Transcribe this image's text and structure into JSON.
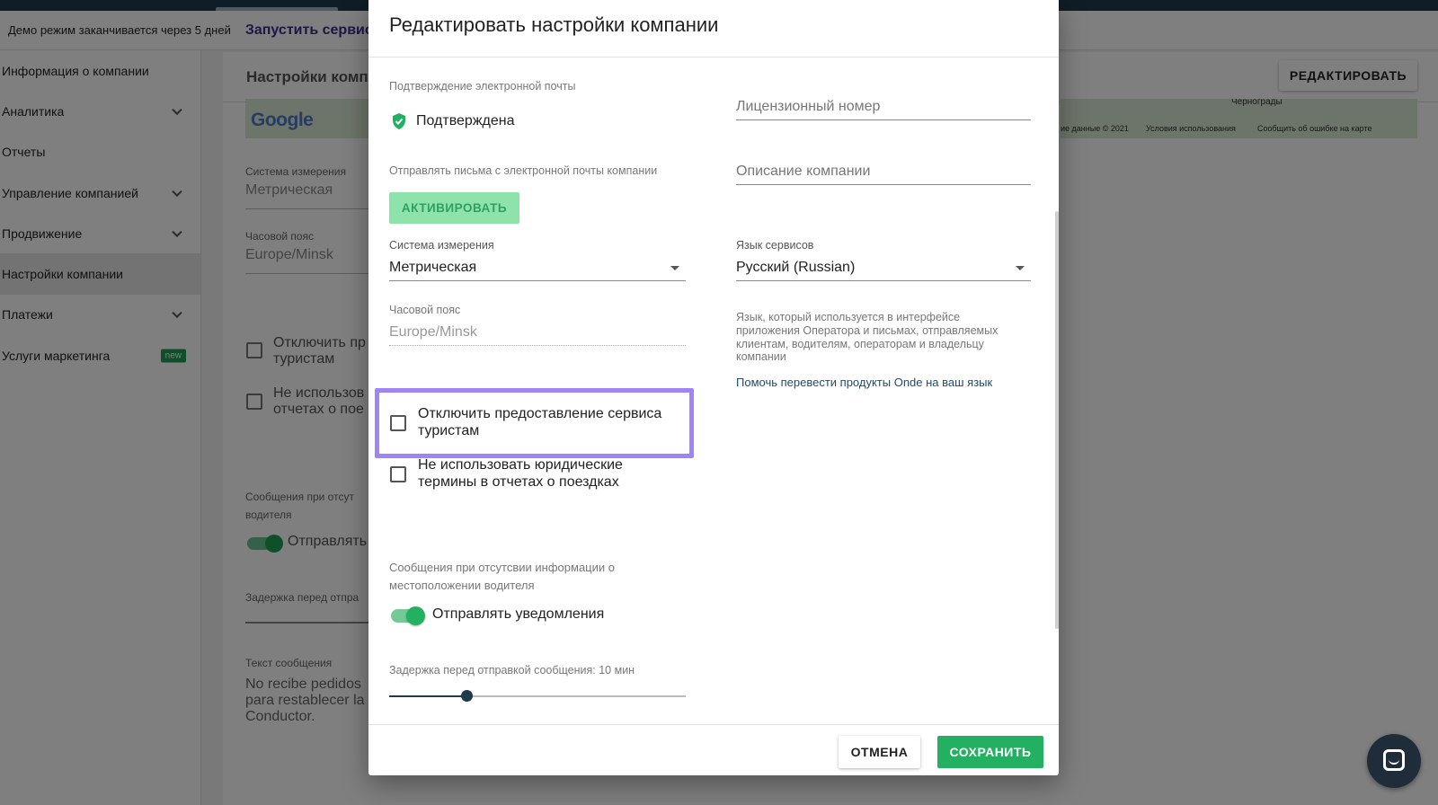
{
  "demo_bar": {
    "notice": "Демо режим заканчивается через 5 дней",
    "launch_link": "Запустить сервис"
  },
  "sidebar": {
    "items": [
      {
        "label": "Информация о компании",
        "has_chevron": false
      },
      {
        "label": "Аналитика",
        "has_chevron": true
      },
      {
        "label": "Отчеты",
        "has_chevron": false
      },
      {
        "label": "Управление компанией",
        "has_chevron": true
      },
      {
        "label": "Продвижение",
        "has_chevron": true
      },
      {
        "label": "Настройки компании",
        "has_chevron": false,
        "active": true
      },
      {
        "label": "Платежи",
        "has_chevron": true
      },
      {
        "label": "Услуги маркетинга",
        "has_chevron": false,
        "badge": "new"
      }
    ]
  },
  "background": {
    "page_title": "Настройки компании",
    "edit_button": "РЕДАКТИРОВАТЬ",
    "map": {
      "logo": "Google",
      "city": "Чернограды",
      "map_data": "ие данные © 2021",
      "terms": "Условия использования",
      "report": "Сообщить об ошибке на карте"
    },
    "measure_label": "Система измерения",
    "measure_value": "Метрическая",
    "timezone_label": "Часовой пояс",
    "timezone_value": "Europe/Minsk",
    "checkbox1_text": "Отключить пр\nтуристам",
    "checkbox2_text": "Не использов\nотчетах о пое",
    "messages_label": "Сообщения при отсут\nводителя",
    "toggle_text": "Отправлять",
    "delay_label": "Задержка перед отпра",
    "msg_text_label": "Текст сообщения",
    "msg_text_value": "No recibe pedidos\npara restablecer la\nConductor."
  },
  "modal": {
    "title": "Редактировать настройки компании",
    "email_confirm_label": "Подтверждение электронной почты",
    "email_confirm_value": "Подтверждена",
    "license_placeholder": "Лицензионный номер",
    "send_from_company_label": "Отправлять письма с электронной почты компании",
    "description_placeholder": "Описание компании",
    "activate_button": "АКТИВИРОВАТЬ",
    "measure_label": "Система измерения",
    "measure_value": "Метрическая",
    "language_label": "Язык сервисов",
    "language_value": "Русский (Russian)",
    "timezone_label": "Часовой пояс",
    "timezone_value": "Europe/Minsk",
    "language_help": "Язык, который используется в интерфейсе приложения Оператора и письмах, отправляемых клиентам, водителям, операторам и владельцу компании",
    "translate_link": "Помочь перевести продукты Onde на ваш язык",
    "disable_tourists": "Отключить предоставление сервиса туристам",
    "no_legal_terms": "Не использовать юридические термины в отчетах о поездках",
    "messages_label": "Сообщения при отсутсвии информации о местоположении водителя",
    "send_notifications": "Отправлять уведомления",
    "send_notifications_on": true,
    "delay_label": "Задержка перед отправкой сообщения: 10 мин",
    "delay_fraction": 0.26,
    "cancel_button": "ОТМЕНА",
    "save_button": "СОХРАНИТЬ"
  },
  "colors": {
    "accent_green": "#23b061",
    "highlight": "#a084f5",
    "dark_navy": "#1f3a4d"
  }
}
